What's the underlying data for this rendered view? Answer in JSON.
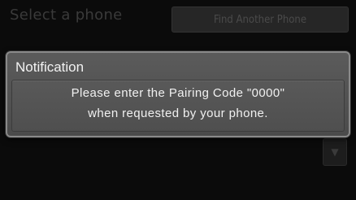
{
  "background": {
    "title": "Select a phone",
    "find_button_label": "Find Another Phone",
    "scroll_icon": "chevron-down-icon"
  },
  "notification": {
    "title": "Notification",
    "message_line_1": "Please enter the Pairing Code \"0000\"",
    "message_line_2": "when requested by your phone."
  },
  "colors": {
    "screen_background": "#0b0b0b",
    "dialog_background": "#555555",
    "dialog_border": "#8a8a8a",
    "dialog_text": "#f0f0f0"
  }
}
